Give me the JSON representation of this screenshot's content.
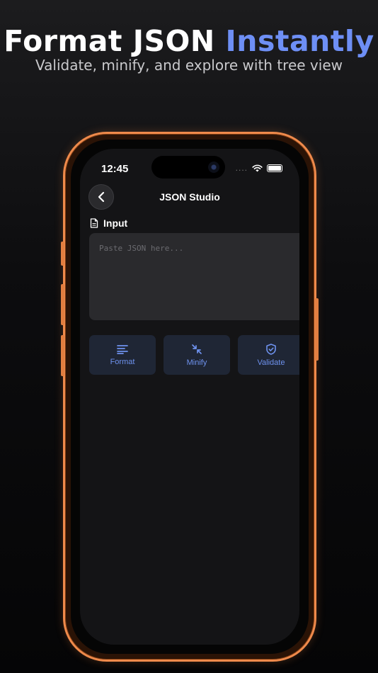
{
  "headline": {
    "part1": "Format JSON ",
    "accent": "Instantly"
  },
  "subheadline": "Validate, minify, and explore with tree view",
  "status_bar": {
    "time": "12:45",
    "signal": "...."
  },
  "nav": {
    "title": "JSON Studio"
  },
  "input": {
    "label": "Input",
    "placeholder": "Paste JSON here...",
    "value": ""
  },
  "actions": [
    {
      "label": "Format",
      "icon": "format-lines-icon"
    },
    {
      "label": "Minify",
      "icon": "minify-arrows-icon"
    },
    {
      "label": "Validate",
      "icon": "shield-check-icon"
    }
  ],
  "colors": {
    "accent": "#6e8ff5",
    "frame": "#ef8a4b",
    "button_bg": "#1f2635",
    "button_text": "#6e92ee"
  }
}
